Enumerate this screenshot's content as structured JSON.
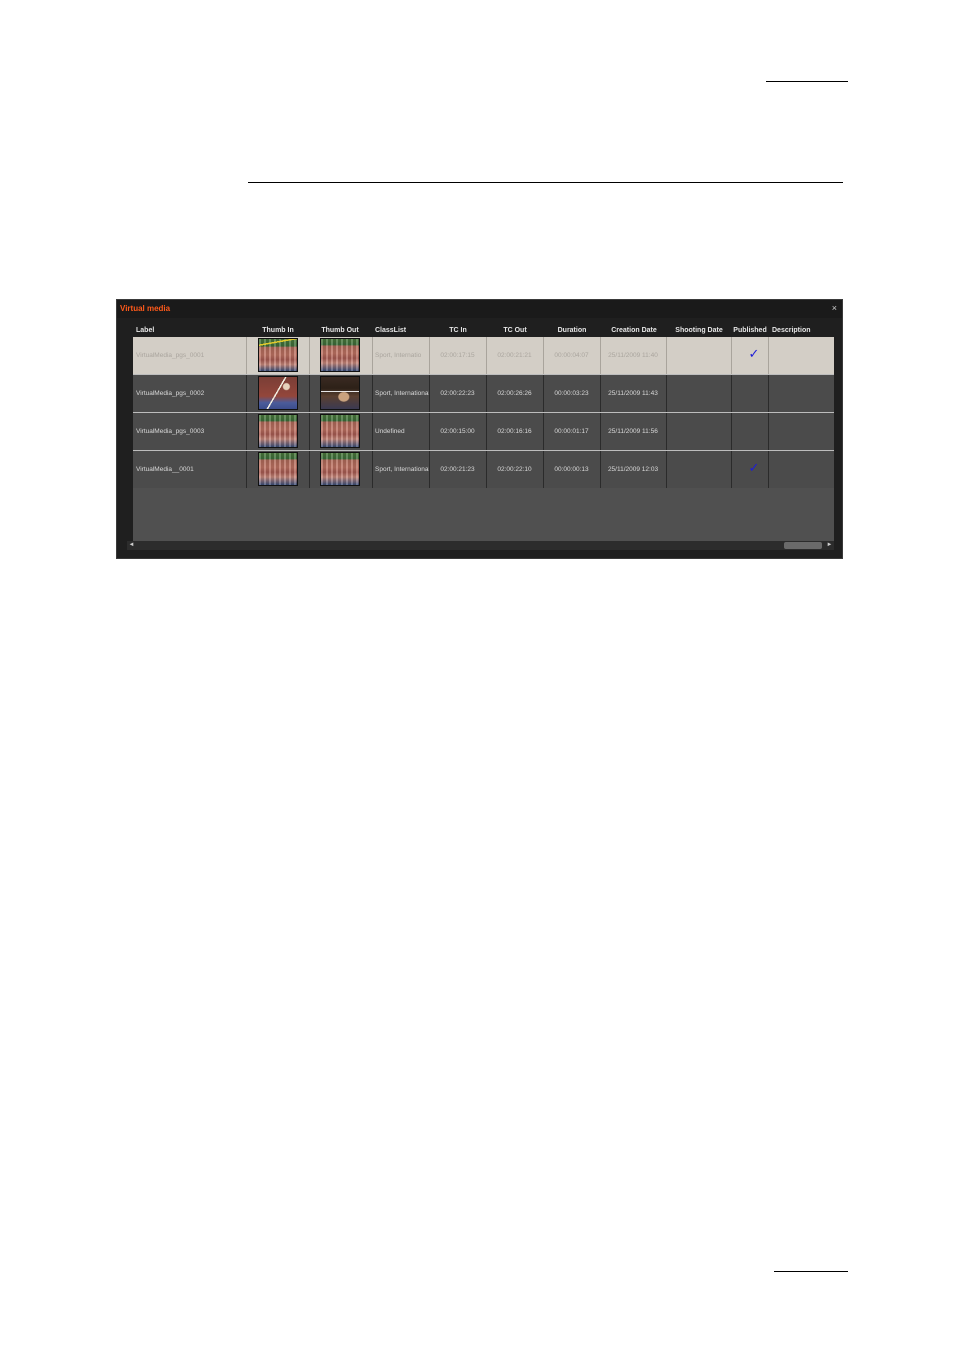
{
  "window": {
    "title": "Virtual media",
    "close_glyph": "×",
    "accent_color": "#ff5a1a"
  },
  "columns": [
    {
      "key": "label",
      "title": "Label"
    },
    {
      "key": "thumb_in",
      "title": "Thumb In"
    },
    {
      "key": "thumb_out",
      "title": "Thumb Out"
    },
    {
      "key": "classlist",
      "title": "ClassList"
    },
    {
      "key": "tc_in",
      "title": "TC In"
    },
    {
      "key": "tc_out",
      "title": "TC Out"
    },
    {
      "key": "duration",
      "title": "Duration"
    },
    {
      "key": "creation_date",
      "title": "Creation Date"
    },
    {
      "key": "shooting_date",
      "title": "Shooting Date"
    },
    {
      "key": "published",
      "title": "Published"
    },
    {
      "key": "description",
      "title": "Description"
    }
  ],
  "rows": [
    {
      "label": "VirtualMedia_pgs_0001",
      "classlist": "Sport, Internatio",
      "tc_in": "02:00:17:15",
      "tc_out": "02:00:21:21",
      "duration": "00:00:04:07",
      "creation_date": "25/11/2009 11:40",
      "shooting_date": "",
      "published": true,
      "published_glyph": "✓",
      "description": "",
      "thumb_in": "stadium-crowd-thumbnail",
      "thumb_out": "stadium-crowd-thumbnail"
    },
    {
      "label": "VirtualMedia_pgs_0002",
      "classlist": "Sport, International",
      "tc_in": "02:00:22:23",
      "tc_out": "02:00:26:26",
      "duration": "00:00:03:23",
      "creation_date": "25/11/2009 11:43",
      "shooting_date": "",
      "published": false,
      "published_glyph": "",
      "description": "",
      "thumb_in": "jump-track-thumbnail",
      "thumb_out": "high-jump-bar-thumbnail"
    },
    {
      "label": "VirtualMedia_pgs_0003",
      "classlist": "Undefined",
      "tc_in": "02:00:15:00",
      "tc_out": "02:00:16:16",
      "duration": "00:00:01:17",
      "creation_date": "25/11/2009 11:56",
      "shooting_date": "",
      "published": false,
      "published_glyph": "",
      "description": "",
      "thumb_in": "stadium-crowd-thumbnail",
      "thumb_out": "stadium-crowd-thumbnail"
    },
    {
      "label": "VirtualMedia__0001",
      "classlist": "Sport, International",
      "tc_in": "02:00:21:23",
      "tc_out": "02:00:22:10",
      "duration": "00:00:00:13",
      "creation_date": "25/11/2009 12:03",
      "shooting_date": "",
      "published": true,
      "published_glyph": "✓",
      "description": "",
      "thumb_in": "stadium-crowd-thumbnail",
      "thumb_out": "stadium-crowd-thumbnail"
    }
  ],
  "scrollbar": {
    "left_arrow": "◄",
    "right_arrow": "►"
  }
}
